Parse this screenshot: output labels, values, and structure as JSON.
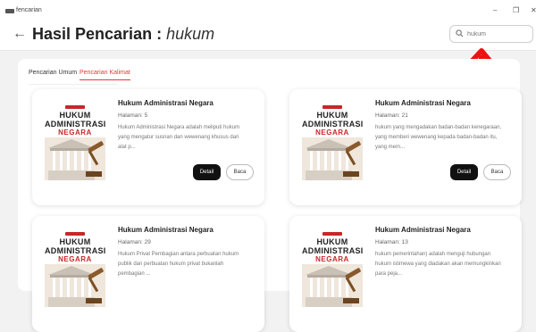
{
  "app": {
    "name": "fencarian"
  },
  "window": {
    "minimize": "–",
    "maximize": "❐",
    "close": "✕"
  },
  "header": {
    "back": "←",
    "title_prefix": "Hasil Pencarian :",
    "query": "hukum"
  },
  "search": {
    "value": "hukum"
  },
  "tabs": [
    {
      "label": "Pencarian Umum",
      "active": false
    },
    {
      "label": "Pencarian Kalimat",
      "active": true
    }
  ],
  "cover": {
    "line1": "HUKUM",
    "line2": "ADMINISTRASI",
    "line3": "NEGARA"
  },
  "buttons": {
    "detail": "Detail",
    "baca": "Baca"
  },
  "results": [
    {
      "title": "Hukum Administrasi Negara",
      "page": "Halaman: 5",
      "snippet": "Hukum Administrasi Negara adalah meliputi hukum yang mengatur susnan dan wewenang khusus dari alat p..."
    },
    {
      "title": "Hukum Administrasi Negara",
      "page": "Halaman: 21",
      "snippet": "hukum yang mengadakan badan-badan kenegaraan, yang memberi wewenang kepada badan-badan itu, yang mem..."
    },
    {
      "title": "Hukum Administrasi Negara",
      "page": "Halaman: 29",
      "snippet": "Hukum Privat Pembagian antara perbuatan hukum publik dan perbuatan hukum privat bukanlah pembagian ..."
    },
    {
      "title": "Hukum Administrasi Negara",
      "page": "Halaman: 13",
      "snippet": "hukum pemerintahan) adalah menguji hubungan hukum istimewa yang diadakan akan memungkinkan para peja..."
    }
  ],
  "colors": {
    "accent": "#e53935",
    "primary_button": "#111111",
    "arrow": "#ee1111"
  }
}
